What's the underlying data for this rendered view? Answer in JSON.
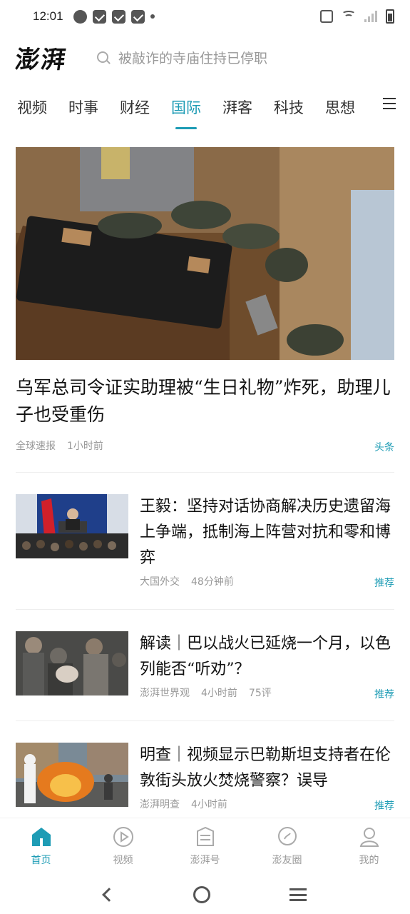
{
  "status_bar": {
    "time": "12:01"
  },
  "header": {
    "logo": "澎湃",
    "search_placeholder": "被敲诈的寺庙住持已停职"
  },
  "tabs": [
    {
      "label": "视频"
    },
    {
      "label": "时事"
    },
    {
      "label": "财经"
    },
    {
      "label": "国际",
      "active": true
    },
    {
      "label": "湃客"
    },
    {
      "label": "科技"
    },
    {
      "label": "思想"
    }
  ],
  "hero": {
    "title": "乌军总司令证实助理被“生日礼物”炸死，助理儿子也受重伤",
    "source": "全球速报",
    "time": "1小时前",
    "tag": "头条"
  },
  "articles": [
    {
      "title": "王毅：坚持对话协商解决历史遗留海上争端，抵制海上阵营对抗和零和博弈",
      "source": "大国外交",
      "time": "48分钟前",
      "comments": "",
      "tag": "推荐"
    },
    {
      "title": "解读｜巴以战火已延烧一个月，以色列能否“听劝”？",
      "source": "澎湃世界观",
      "time": "4小时前",
      "comments": "75评",
      "tag": "推荐"
    },
    {
      "title": "明查｜视频显示巴勒斯坦支持者在伦敦街头放火焚烧警察？误导",
      "source": "澎湃明查",
      "time": "4小时前",
      "comments": "",
      "tag": "推荐"
    }
  ],
  "bottom_nav": [
    {
      "label": "首页",
      "icon": "home-icon",
      "active": true
    },
    {
      "label": "视频",
      "icon": "video-icon"
    },
    {
      "label": "澎湃号",
      "icon": "account-icon"
    },
    {
      "label": "澎友圈",
      "icon": "chat-icon"
    },
    {
      "label": "我的",
      "icon": "user-icon"
    }
  ],
  "colors": {
    "accent": "#1e9cb5",
    "text": "#111111",
    "meta": "#999999"
  }
}
